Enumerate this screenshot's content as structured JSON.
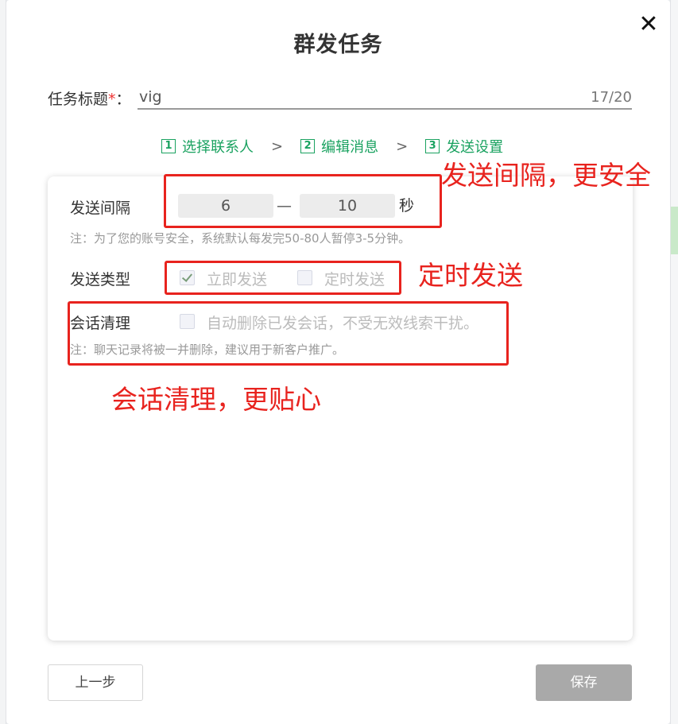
{
  "dialog": {
    "title": "群发任务",
    "close_glyph": "✕"
  },
  "task_title": {
    "label": "任务标题",
    "required_mark": "*",
    "colon": "：",
    "value": "vig",
    "counter": "17/20"
  },
  "steps": [
    {
      "num": "1",
      "label": "选择联系人"
    },
    {
      "num": "2",
      "label": "编辑消息"
    },
    {
      "num": "3",
      "label": "发送设置"
    }
  ],
  "step_separator": ">",
  "interval": {
    "label": "发送间隔",
    "min": "6",
    "dash": "—",
    "max": "10",
    "unit": "秒",
    "note": "注：为了您的账号安全，系统默认每发完50-80人暂停3-5分钟。"
  },
  "send_type": {
    "label": "发送类型",
    "options": [
      {
        "label": "立即发送",
        "checked": true
      },
      {
        "label": "定时发送",
        "checked": false
      }
    ]
  },
  "session_cleanup": {
    "label": "会话清理",
    "option_label": "自动删除已发会话，不受无效线索干扰。",
    "checked": false,
    "note": "注：聊天记录将被一并删除，建议用于新客户推广。"
  },
  "annotations": {
    "interval": "发送间隔，更安全",
    "scheduled": "定时发送",
    "cleanup": "会话清理，更贴心",
    "color": "#e8231e"
  },
  "buttons": {
    "prev": "上一步",
    "save": "保存"
  },
  "colors": {
    "accent_green": "#1aa260",
    "save_disabled": "#a9a9a9"
  }
}
